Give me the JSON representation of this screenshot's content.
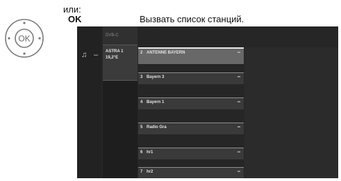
{
  "instruction": {
    "or_label": "или:",
    "key_label": "OK",
    "description": "Вызвать список станций."
  },
  "remote": {
    "button_label": "OK",
    "icon": "ok-button-icon"
  },
  "tv": {
    "icons": {
      "music": "music-note-icon",
      "music_glyph": "♫",
      "dash_glyph": "–"
    },
    "satellite_column": {
      "top_label": "DVB-C",
      "selected_name": "ASTRA 1",
      "selected_position": "19,2°E"
    },
    "stations": [
      {
        "number": "2",
        "name": "ANTENNE BAYERN",
        "selected": true
      },
      {
        "number": "3",
        "name": "Bayern 3",
        "selected": false
      },
      {
        "number": "4",
        "name": "Bayern 1",
        "selected": false
      },
      {
        "number": "5",
        "name": "Radio Gra",
        "selected": false
      },
      {
        "number": "6",
        "name": "hr1",
        "selected": false
      },
      {
        "number": "7",
        "name": "hr2",
        "selected": false
      }
    ],
    "station_icon_glyph": "▪▪"
  }
}
